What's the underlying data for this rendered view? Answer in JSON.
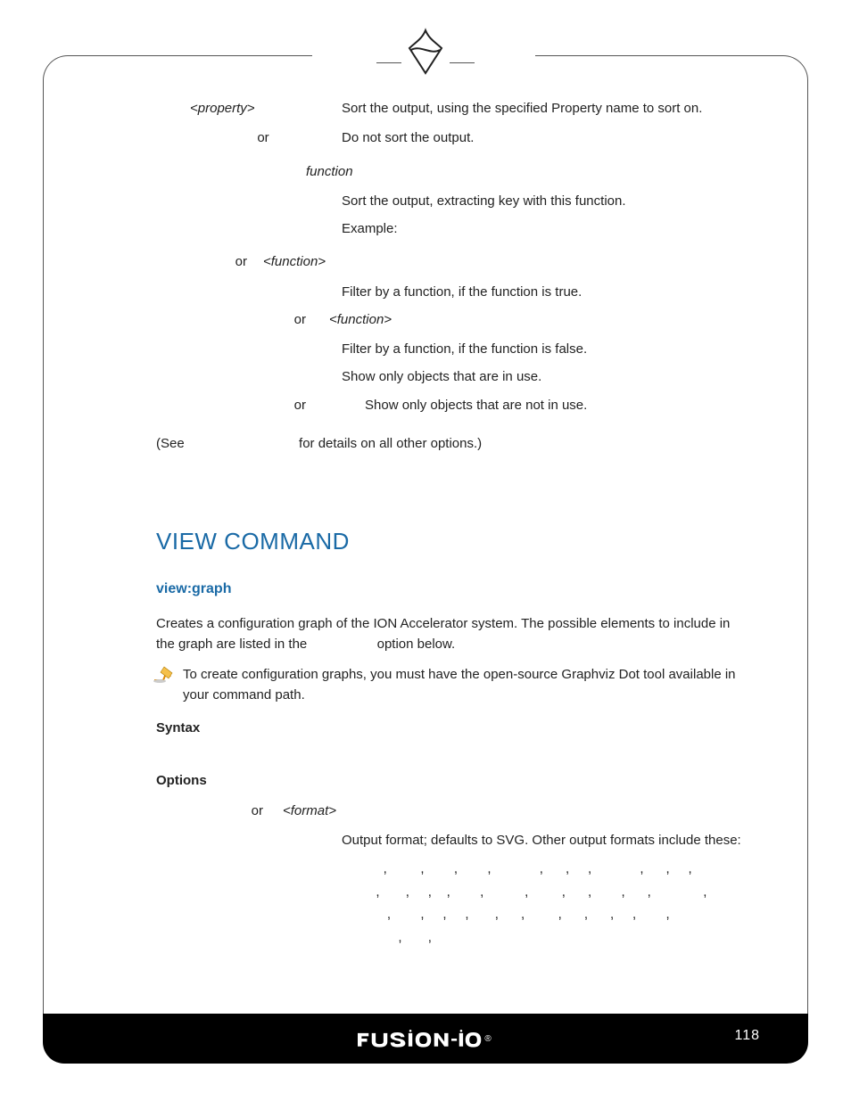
{
  "options_top": {
    "row1_opt": "<property>",
    "row1_desc": "Sort the output, using the specified Property name to sort on.",
    "row2_opt": "or",
    "row2_desc": "Do not sort the output.",
    "func_label": "function",
    "func_desc1": "Sort the output, extracting key with this function.",
    "func_desc2": "Example:",
    "row3_or": "or",
    "row3_opt": "<function>",
    "row3_desc": "Filter by a function, if the function is true.",
    "row4_or": "or",
    "row4_opt": "<function>",
    "row4_desc": "Filter by a function, if the function is false.",
    "row5_desc": "Show only objects that are in use.",
    "row6_or": "or",
    "row6_desc": "Show only objects that are not in use."
  },
  "see_line": {
    "pre": "(See",
    "post": "for details on all other options.)"
  },
  "view": {
    "heading": "VIEW COMMAND",
    "sub": "view:graph",
    "para_a": "Creates a configuration graph of the ION Accelerator system. The possible elements to include in the graph are listed in the",
    "para_b": "option below.",
    "note": "To create configuration graphs, you must have the open-source Graphviz Dot tool available in your command path.",
    "syntax": "Syntax",
    "options": "Options",
    "fmt_or": "or",
    "fmt_arg": "<format>",
    "fmt_desc": "Output format; defaults to SVG. Other output formats include these:"
  },
  "footer": {
    "brand": "FUSiON-iO",
    "reg": "®",
    "page": "118"
  }
}
